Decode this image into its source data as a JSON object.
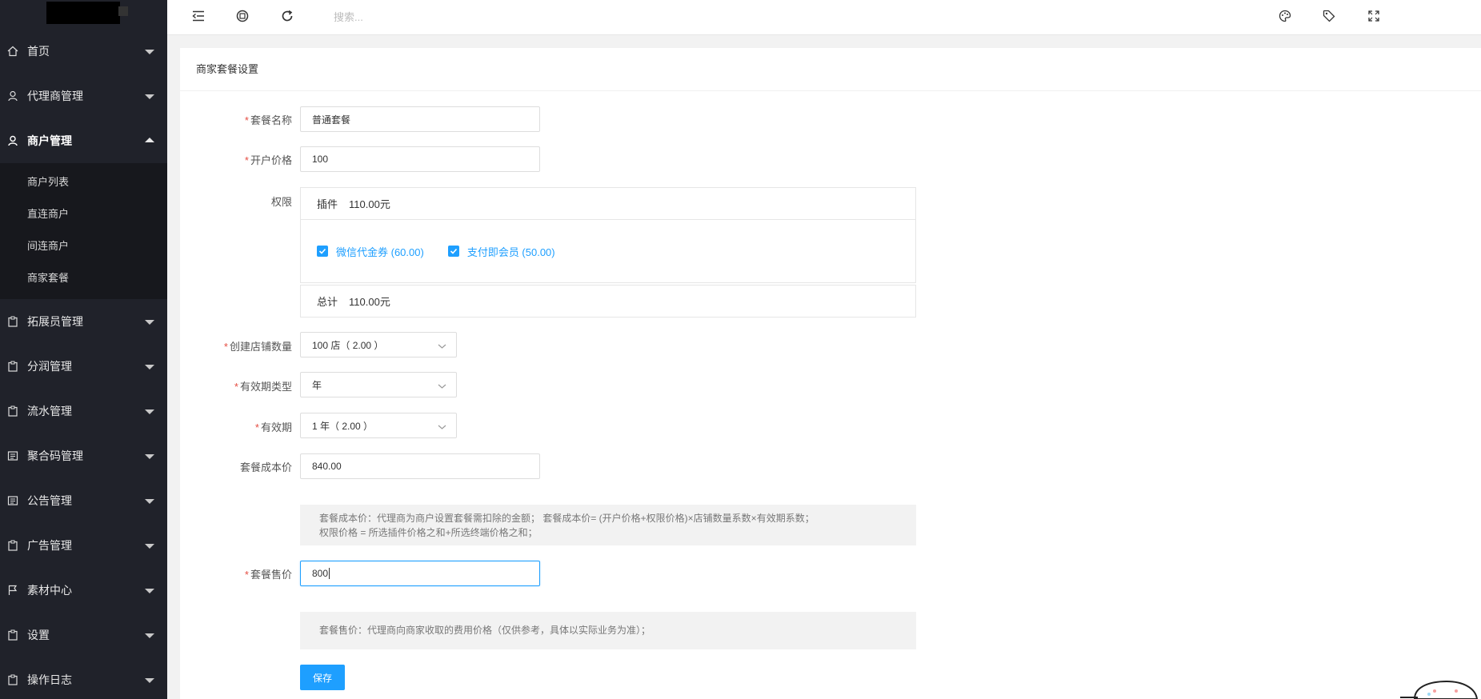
{
  "sidebar": {
    "items": [
      {
        "label": "首页",
        "icon": "home-icon"
      },
      {
        "label": "代理商管理",
        "icon": "user-icon"
      },
      {
        "label": "商户管理",
        "icon": "user-icon",
        "expanded": true
      },
      {
        "label": "拓展员管理",
        "icon": "clipboard-icon"
      },
      {
        "label": "分润管理",
        "icon": "clipboard-icon"
      },
      {
        "label": "流水管理",
        "icon": "clipboard-icon"
      },
      {
        "label": "聚合码管理",
        "icon": "list-icon"
      },
      {
        "label": "公告管理",
        "icon": "list-icon"
      },
      {
        "label": "广告管理",
        "icon": "clipboard-icon"
      },
      {
        "label": "素材中心",
        "icon": "flag-icon"
      },
      {
        "label": "设置",
        "icon": "clipboard-icon"
      },
      {
        "label": "操作日志",
        "icon": "clipboard-icon"
      }
    ],
    "submenu": [
      "商户列表",
      "直连商户",
      "间连商户",
      "商家套餐"
    ]
  },
  "header": {
    "search_placeholder": "搜索..."
  },
  "card": {
    "title": "商家套餐设置"
  },
  "form": {
    "package_name_label": "套餐名称",
    "package_name_value": "普通套餐",
    "open_price_label": "开户价格",
    "open_price_value": "100",
    "permission_label": "权限",
    "plugin_label": "插件",
    "plugin_amount": "110.00元",
    "checkbox1": "微信代金券 (60.00)",
    "checkbox2": "支付即会员 (50.00)",
    "total_label": "总计",
    "total_amount": "110.00元",
    "store_count_label": "创建店铺数量",
    "store_count_value": "100 店（ 2.00 ）",
    "validity_type_label": "有效期类型",
    "validity_type_value": "年",
    "validity_label": "有效期",
    "validity_value": "1 年（ 2.00 ）",
    "cost_label": "套餐成本价",
    "cost_value": "840.00",
    "cost_note_line1": "套餐成本价：代理商为商户设置套餐需扣除的金额； 套餐成本价= (开户价格+权限价格)×店铺数量系数×有效期系数；",
    "cost_note_line2": "权限价格 = 所选插件价格之和+所选终端价格之和；",
    "sale_label": "套餐售价",
    "sale_value": "800",
    "sale_note": "套餐售价：代理商向商家收取的费用价格（仅供参考，具体以实际业务为准）；",
    "save_label": "保存"
  },
  "colors": {
    "sidebar_bg": "#20222a",
    "primary": "#1e9fff",
    "required": "#e54d42"
  }
}
